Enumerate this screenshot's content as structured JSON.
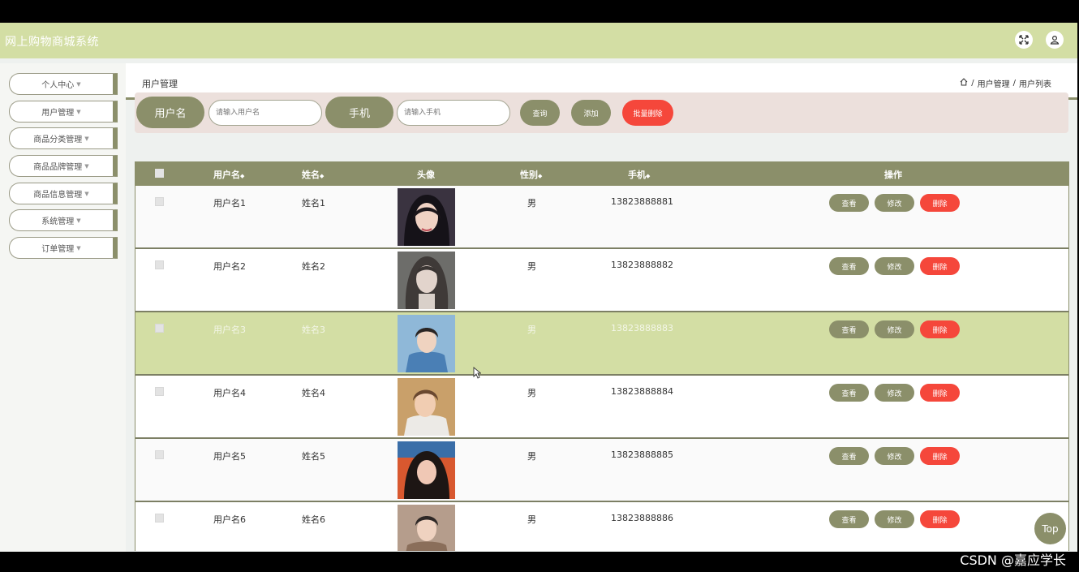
{
  "app": {
    "title": "网上购物商城系统"
  },
  "sidebar": {
    "items": [
      {
        "label": "个人中心"
      },
      {
        "label": "用户管理"
      },
      {
        "label": "商品分类管理"
      },
      {
        "label": "商品品牌管理"
      },
      {
        "label": "商品信息管理"
      },
      {
        "label": "系统管理"
      },
      {
        "label": "订单管理"
      }
    ]
  },
  "header": {
    "page_title": "用户管理",
    "breadcrumb": [
      "用户管理",
      "用户列表"
    ],
    "separator": "/"
  },
  "search": {
    "username_label": "用户名",
    "username_placeholder": "请输入用户名",
    "phone_label": "手机",
    "phone_placeholder": "请输入手机",
    "query_button": "查询",
    "add_button": "添加",
    "batch_delete_button": "批量删除"
  },
  "table": {
    "columns": [
      "用户名",
      "姓名",
      "头像",
      "性别",
      "手机",
      "操作"
    ],
    "sort_marker": "◆",
    "actions": {
      "view": "查看",
      "edit": "修改",
      "delete": "删除"
    },
    "rows": [
      {
        "username": "用户名1",
        "name": "姓名1",
        "gender": "男",
        "phone": "13823888881"
      },
      {
        "username": "用户名2",
        "name": "姓名2",
        "gender": "男",
        "phone": "13823888882"
      },
      {
        "username": "用户名3",
        "name": "姓名3",
        "gender": "男",
        "phone": "13823888883"
      },
      {
        "username": "用户名4",
        "name": "姓名4",
        "gender": "男",
        "phone": "13823888884"
      },
      {
        "username": "用户名5",
        "name": "姓名5",
        "gender": "男",
        "phone": "13823888885"
      },
      {
        "username": "用户名6",
        "name": "姓名6",
        "gender": "男",
        "phone": "13823888886"
      }
    ]
  },
  "back_to_top": "Top",
  "watermark": "CSDN @嘉应学长",
  "colors": {
    "accent": "#8b8f6a",
    "topbar": "#d3dea4",
    "highlight_row": "#d3dea4",
    "danger": "#f5473b",
    "search_bg": "#ece0dc"
  }
}
